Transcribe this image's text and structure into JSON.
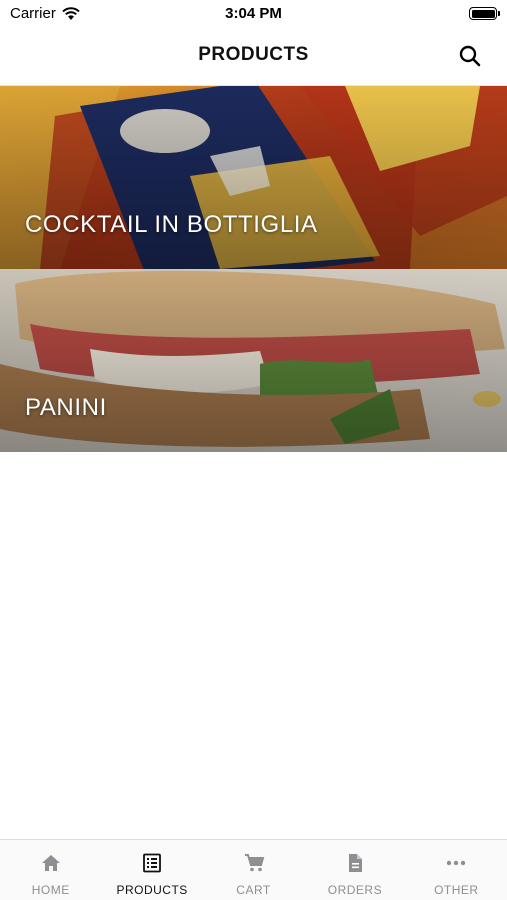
{
  "status_bar": {
    "carrier": "Carrier",
    "time": "3:04 PM"
  },
  "header": {
    "title": "PRODUCTS"
  },
  "categories": [
    {
      "label": "COCKTAIL IN BOTTIGLIA"
    },
    {
      "label": "PANINI"
    }
  ],
  "tab_bar": {
    "active": "PRODUCTS",
    "items": [
      {
        "label": "HOME",
        "icon": "home-icon"
      },
      {
        "label": "PRODUCTS",
        "icon": "list-icon"
      },
      {
        "label": "CART",
        "icon": "cart-icon"
      },
      {
        "label": "ORDERS",
        "icon": "document-icon"
      },
      {
        "label": "OTHER",
        "icon": "more-icon"
      }
    ]
  },
  "colors": {
    "active_tab": "#111111",
    "inactive_tab": "#8e8e93"
  }
}
